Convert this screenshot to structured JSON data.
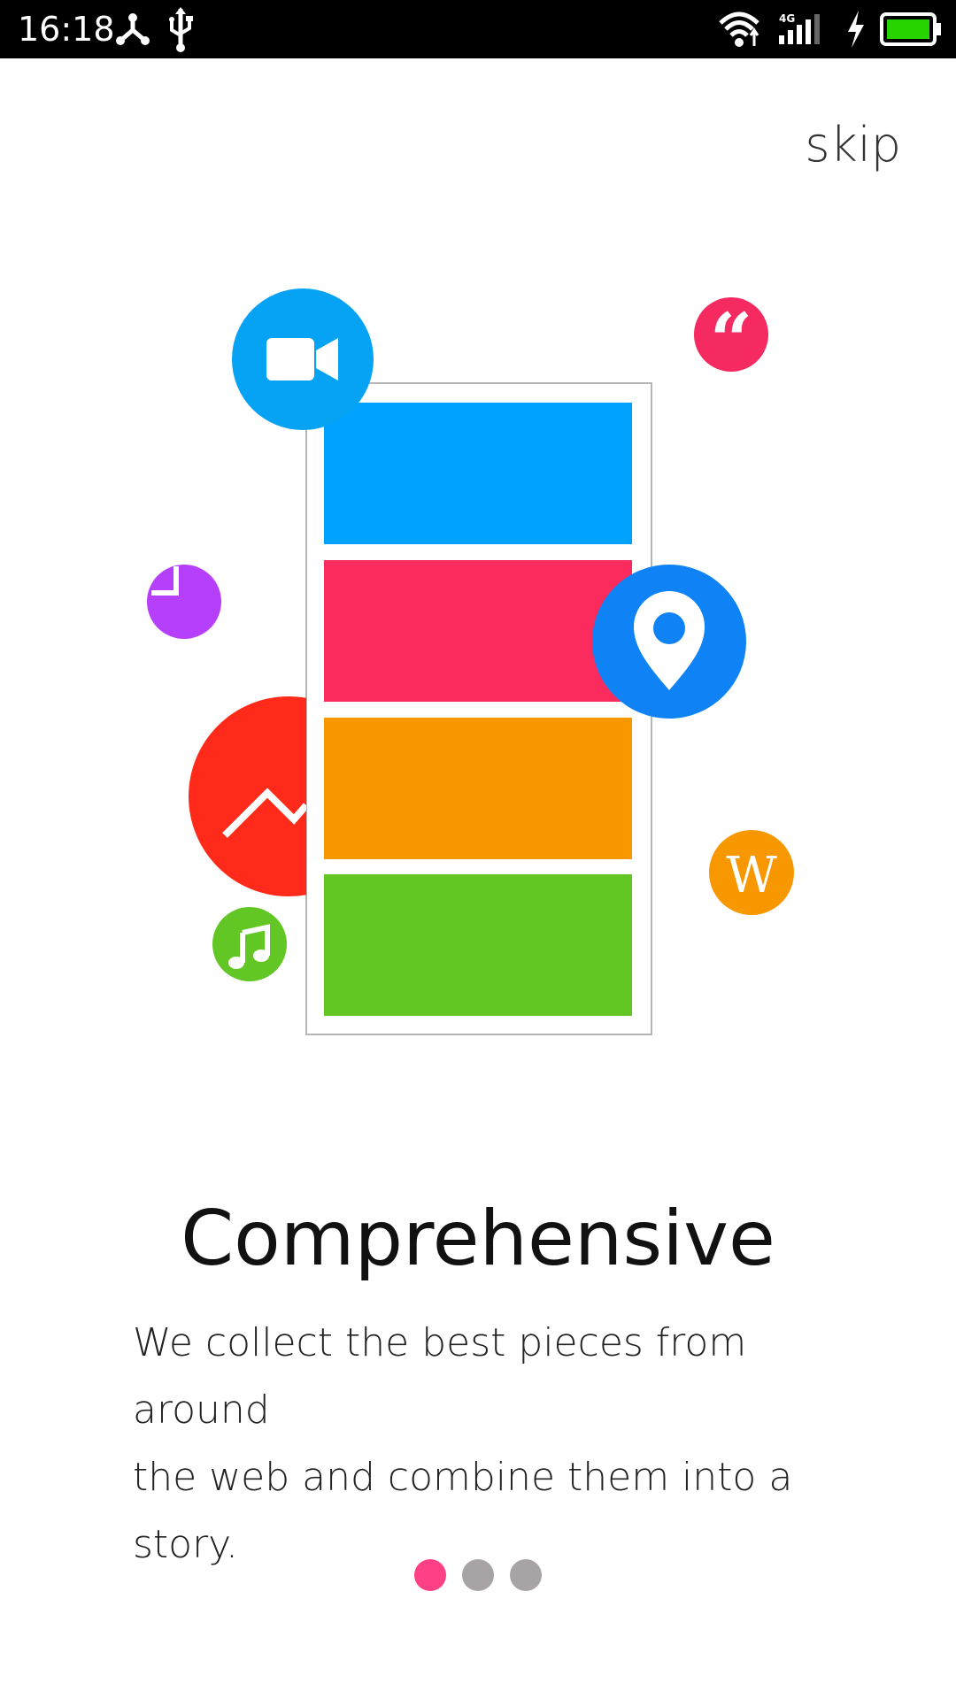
{
  "status_bar": {
    "time": "16:18",
    "network": "4G",
    "icons": [
      "share-icon",
      "usb-icon",
      "wifi-icon",
      "signal-icon",
      "charging-icon",
      "battery-icon"
    ]
  },
  "skip_label": "skip",
  "illustration": {
    "card_colors": [
      "#00a2ff",
      "#fb2b5e",
      "#f79800",
      "#62c724"
    ],
    "bubbles": {
      "video": "#06a2f3",
      "quote": "#f42a61",
      "pie": "#b63ffc",
      "chart": "#ff2a1a",
      "location": "#0f83f5",
      "wikipedia": "#f79800",
      "music": "#62c724"
    },
    "quote_glyph": "“",
    "wiki_glyph": "W"
  },
  "title": "Comprehensive",
  "description": {
    "line1": "We collect the best pieces from around",
    "line2": "the web and combine them into a story."
  },
  "pager": {
    "active_color": "#ff3f86",
    "inactive_color": "#a8a3a5",
    "count": 3,
    "active_index": 0
  }
}
